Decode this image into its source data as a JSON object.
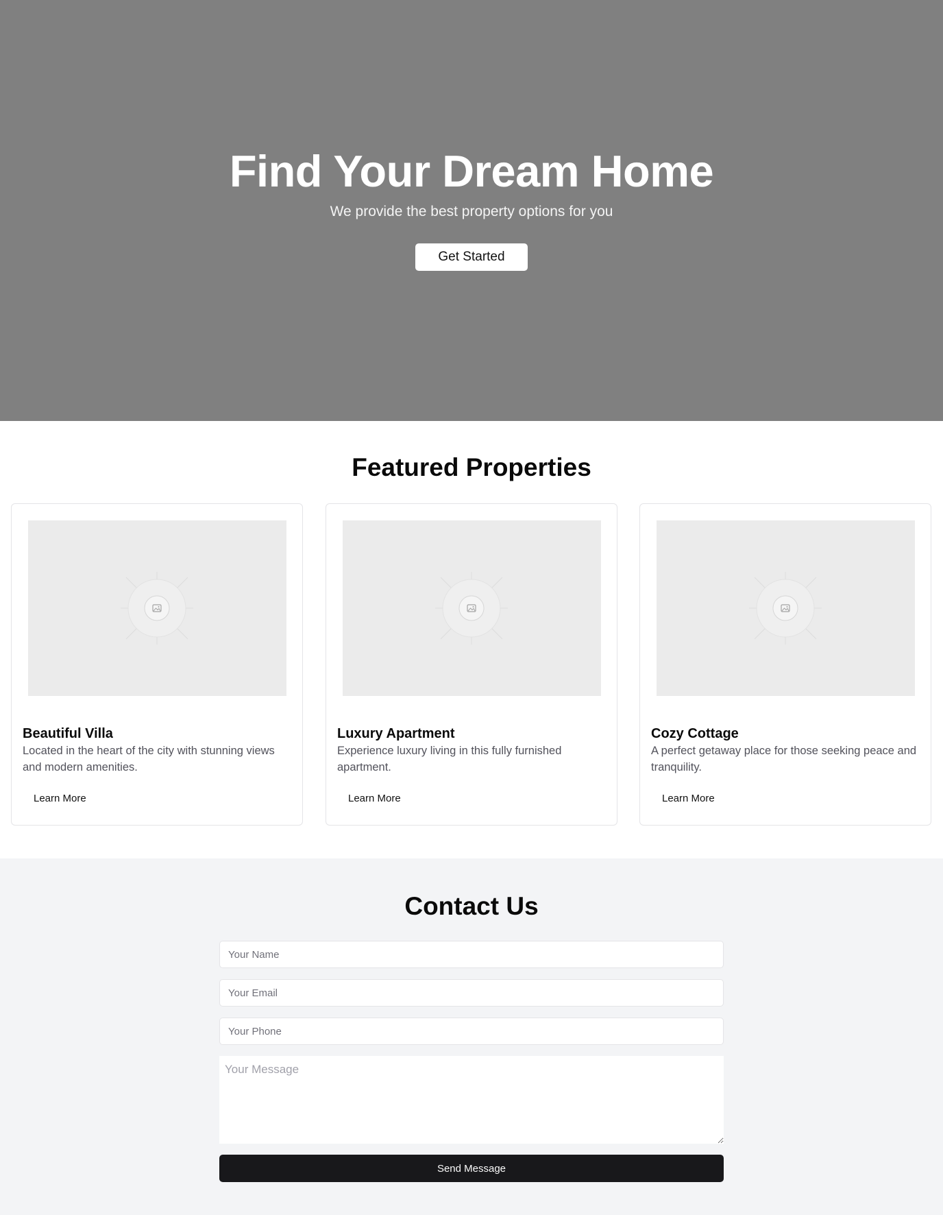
{
  "hero": {
    "title": "Find Your Dream Home",
    "subtitle": "We provide the best property options for you",
    "cta_label": "Get Started",
    "background_color": "#808080"
  },
  "featured": {
    "title": "Featured Properties",
    "cards": [
      {
        "image_icon": "image-placeholder-icon",
        "title": "Beautiful Villa",
        "description": "Located in the heart of the city with stunning views and modern amenities.",
        "link_label": "Learn More"
      },
      {
        "image_icon": "image-placeholder-icon",
        "title": "Luxury Apartment",
        "description": "Experience luxury living in this fully furnished apartment.",
        "link_label": "Learn More"
      },
      {
        "image_icon": "image-placeholder-icon",
        "title": "Cozy Cottage",
        "description": "A perfect getaway place for those seeking peace and tranquility.",
        "link_label": "Learn More"
      }
    ]
  },
  "contact": {
    "title": "Contact Us",
    "name_placeholder": "Your Name",
    "email_placeholder": "Your Email",
    "phone_placeholder": "Your Phone",
    "message_placeholder": "Your Message",
    "send_label": "Send Message",
    "background_color": "#f3f4f6",
    "button_color": "#18181b"
  }
}
